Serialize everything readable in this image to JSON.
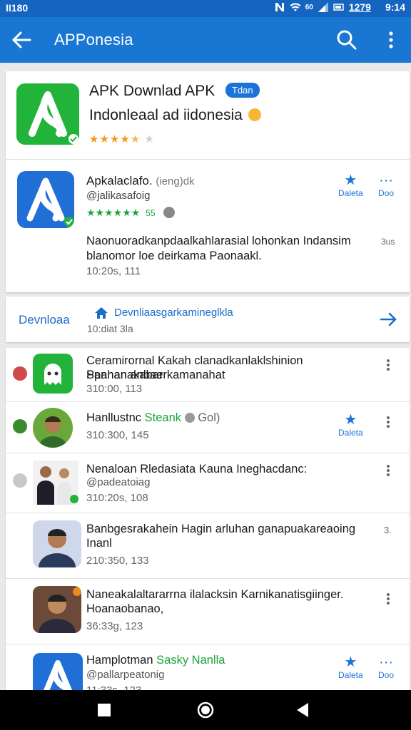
{
  "status_bar": {
    "carrier": "II180",
    "data_label": "60",
    "battery": "1279",
    "time": "9:14"
  },
  "app_bar": {
    "title": "APPonesia"
  },
  "hero": {
    "title": "APK Downlad APK",
    "badge": "Tdan",
    "subtitle": "Indonleaal ad iidonesia",
    "rating_stars": 4.5
  },
  "app_detail": {
    "name": "Apkalaclafo.",
    "name_sub": "(ieng)dk",
    "developer": "@jalikasafoig",
    "rating_count": "55",
    "description": "Naonuoradkanpdaalkahlarasial lohonkan Indansim blanomor loe deirkama Paonaakl.",
    "meta": "10:20s, 111",
    "action_label": "Daleta",
    "more_label": "Doo",
    "more_kebab": "3us"
  },
  "download_bar": {
    "label": "Devnloaa",
    "title": "Devnliaasgarkamineglkla",
    "meta": "10:diat 3la"
  },
  "list": [
    {
      "title": "Ceramirornal Kakah clanadkanlaklshinion Spananakabar",
      "title2": "Panhan anbaerkamanahat",
      "sub": "",
      "meta": "310:00, 113",
      "action": ""
    },
    {
      "title": "Hanllustnc",
      "title_green": "Steank",
      "title_extra": "Gol)",
      "sub": "",
      "meta": "310:300, 145",
      "action": "Daleta"
    },
    {
      "title": "Nenaloan Rledasiata Kauna Ineghacdanc:",
      "title2": "",
      "sub": "@padeatoiag",
      "meta": "310:20s, 108",
      "action": ""
    },
    {
      "title": "Banbgesrakahein Hagin arluhan ganapuakareaoing",
      "title2": "Inanl",
      "sub": "",
      "meta": "210:350, 133",
      "action": "3."
    },
    {
      "title": "Naneakalaltararrna ilalacksin Karnikanatisgiinger.",
      "title2": "Hoanaobanao,",
      "sub": "",
      "meta": "36:33g, 123",
      "action": ""
    },
    {
      "title": "Hamplotman",
      "title_green": "Sasky Nanlla",
      "title2": "",
      "sub": "@pallarpeatonig",
      "meta": "11:33s, 123",
      "action": "Daleta",
      "more_label": "Doo"
    }
  ],
  "colors": {
    "primary": "#1976d2",
    "status_bar": "#1565c0",
    "accent_green": "#22b43a",
    "star": "#f29914"
  }
}
